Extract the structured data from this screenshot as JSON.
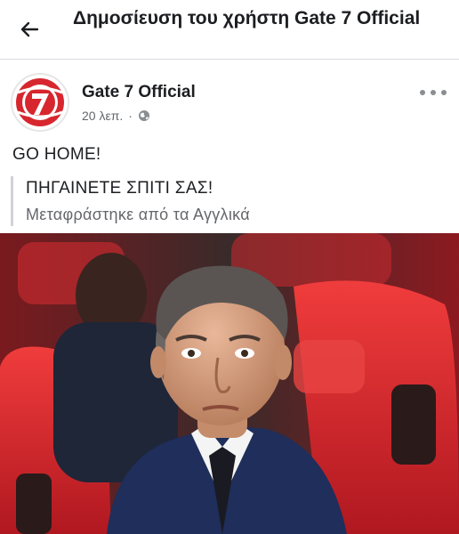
{
  "appbar": {
    "title": "Δημοσίευση του χρήστη Gate 7 Official",
    "back_icon": "arrow-left-icon"
  },
  "post": {
    "author": "Gate 7 Official",
    "time": "20 λεπ.",
    "separator": "·",
    "privacy_icon": "globe-icon",
    "more_icon": "more-horizontal-icon",
    "text": "GO HOME!",
    "translation": {
      "text": "ΠΗΓΑΙΝΕΤΕ ΣΠΙΤΙ ΣΑΣ!",
      "note": "Μεταφράστηκε από τα Αγγλικά"
    },
    "avatar_logo_text": "GATE 7"
  },
  "colors": {
    "accent_red": "#d7262e",
    "text_primary": "#1c1e21",
    "text_secondary": "#65676b",
    "divider": "#d8dadf"
  }
}
